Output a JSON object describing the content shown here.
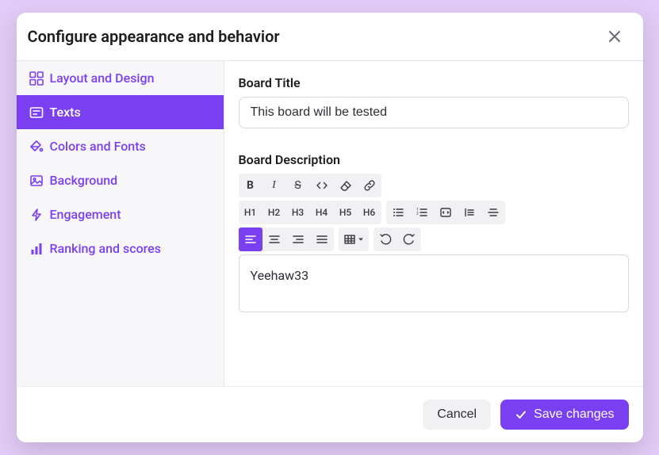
{
  "dialog": {
    "title": "Configure appearance and behavior"
  },
  "sidebar": {
    "items": [
      {
        "label": "Layout and Design"
      },
      {
        "label": "Texts"
      },
      {
        "label": "Colors and Fonts"
      },
      {
        "label": "Background"
      },
      {
        "label": "Engagement"
      },
      {
        "label": "Ranking and scores"
      }
    ]
  },
  "fields": {
    "board_title_label": "Board Title",
    "board_title_value": "This board will be tested",
    "board_description_label": "Board Description",
    "board_description_value": "Yeehaw33"
  },
  "toolbar": {
    "bold": "B",
    "italic": "I",
    "strike": "S",
    "h1": "H1",
    "h2": "H2",
    "h3": "H3",
    "h4": "H4",
    "h5": "H5",
    "h6": "H6"
  },
  "footer": {
    "cancel": "Cancel",
    "save": "Save changes"
  }
}
